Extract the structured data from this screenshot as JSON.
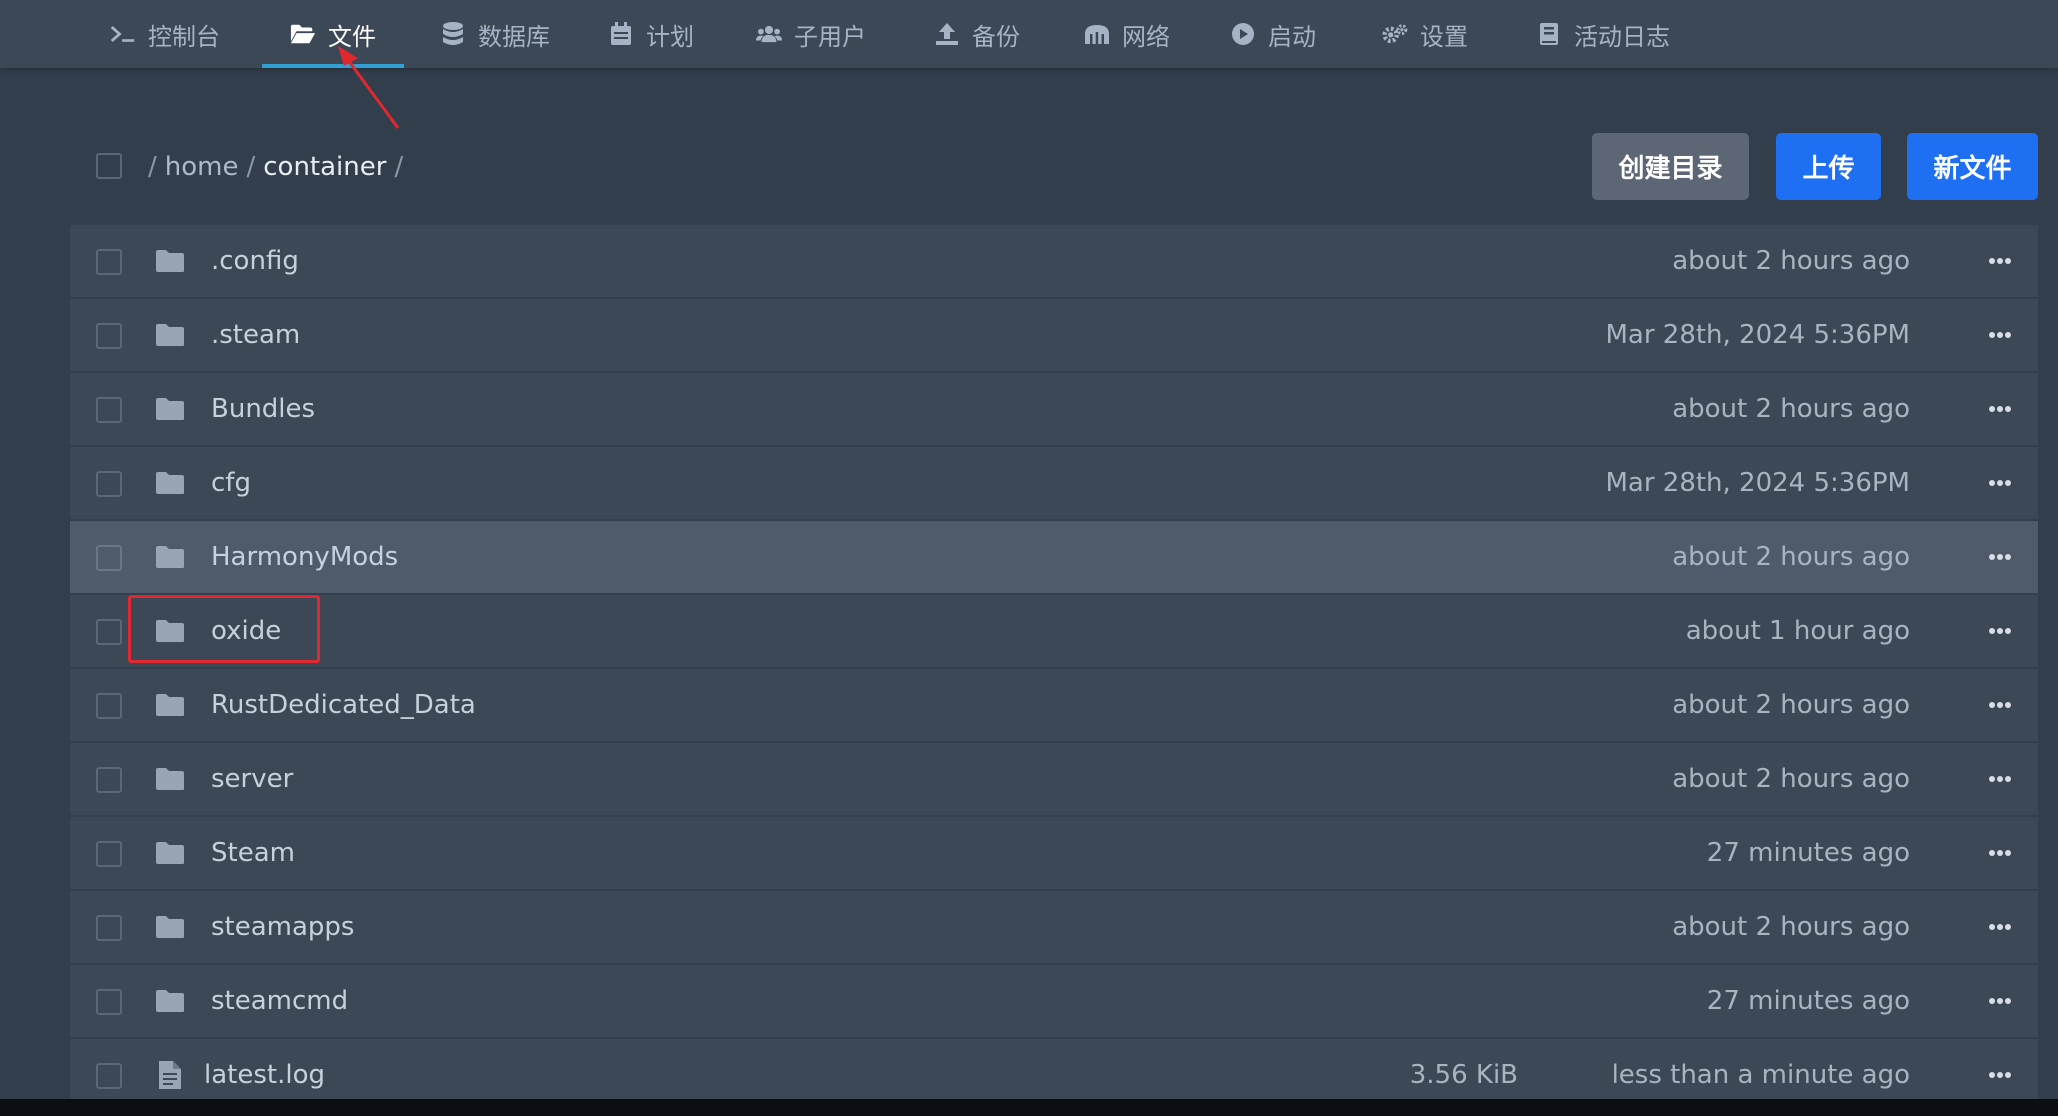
{
  "nav": {
    "items": [
      {
        "label": "控制台",
        "icon": "terminal-icon"
      },
      {
        "label": "文件",
        "icon": "folder-open-icon",
        "active": true
      },
      {
        "label": "数据库",
        "icon": "database-icon"
      },
      {
        "label": "计划",
        "icon": "calendar-icon"
      },
      {
        "label": "子用户",
        "icon": "users-icon"
      },
      {
        "label": "备份",
        "icon": "upload-icon"
      },
      {
        "label": "网络",
        "icon": "network-icon"
      },
      {
        "label": "启动",
        "icon": "play-circle-icon"
      },
      {
        "label": "设置",
        "icon": "cogs-icon"
      },
      {
        "label": "活动日志",
        "icon": "book-icon"
      }
    ]
  },
  "breadcrumb": {
    "separator": "/",
    "parts": [
      "home",
      "container"
    ]
  },
  "actions": {
    "create_dir": "创建目录",
    "upload": "上传",
    "new_file": "新文件"
  },
  "files": [
    {
      "name": ".config",
      "type": "folder",
      "size": "",
      "modified": "about 2 hours ago"
    },
    {
      "name": ".steam",
      "type": "folder",
      "size": "",
      "modified": "Mar 28th, 2024 5:36PM"
    },
    {
      "name": "Bundles",
      "type": "folder",
      "size": "",
      "modified": "about 2 hours ago"
    },
    {
      "name": "cfg",
      "type": "folder",
      "size": "",
      "modified": "Mar 28th, 2024 5:36PM"
    },
    {
      "name": "HarmonyMods",
      "type": "folder",
      "size": "",
      "modified": "about 2 hours ago",
      "hovered": true
    },
    {
      "name": "oxide",
      "type": "folder",
      "size": "",
      "modified": "about 1 hour ago",
      "annotated": true
    },
    {
      "name": "RustDedicated_Data",
      "type": "folder",
      "size": "",
      "modified": "about 2 hours ago"
    },
    {
      "name": "server",
      "type": "folder",
      "size": "",
      "modified": "about 2 hours ago"
    },
    {
      "name": "Steam",
      "type": "folder",
      "size": "",
      "modified": "27 minutes ago"
    },
    {
      "name": "steamapps",
      "type": "folder",
      "size": "",
      "modified": "about 2 hours ago"
    },
    {
      "name": "steamcmd",
      "type": "folder",
      "size": "",
      "modified": "27 minutes ago"
    },
    {
      "name": "latest.log",
      "type": "file",
      "size": "3.56 KiB",
      "modified": "less than a minute ago"
    }
  ],
  "colors": {
    "background": "#333e4c",
    "panel": "#3d4856",
    "row_hover": "#4f5b6a",
    "accent_tab": "#2f9fd4",
    "button_blue": "#1f6ff2",
    "button_gray": "#5c6675",
    "annotation_red": "#e0282e"
  }
}
